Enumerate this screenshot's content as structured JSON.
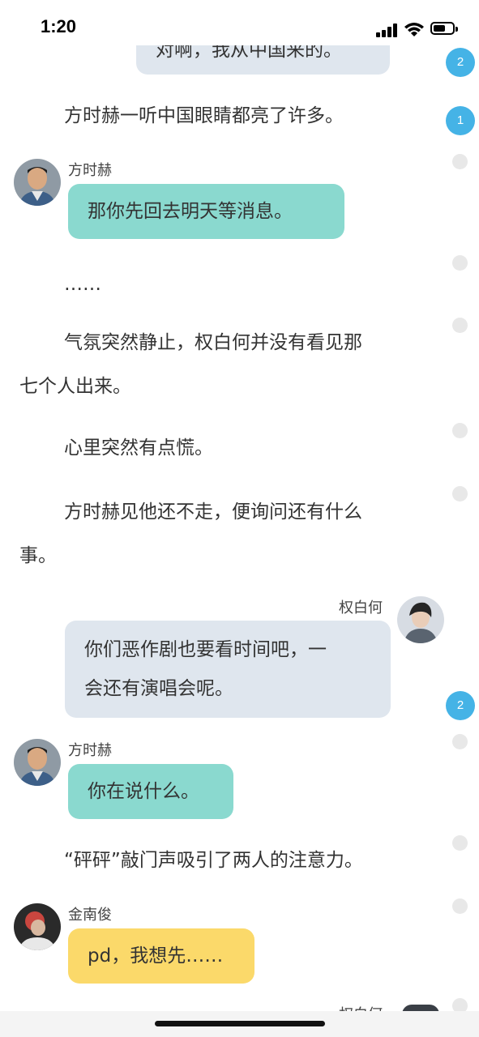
{
  "status": {
    "time": "1:20"
  },
  "top_partial_bubble": "对啊，我从中国来的。",
  "narration_1": "方时赫一听中国眼睛都亮了许多。",
  "msg1": {
    "name": "方时赫",
    "text": "那你先回去明天等消息。"
  },
  "narration_2": "……",
  "narration_3": {
    "line1": "气氛突然静止，权白何并没有看见那",
    "line2": "七个人出来。"
  },
  "narration_4": "心里突然有点慌。",
  "narration_5": {
    "line1": "方时赫见他还不走，便询问还有什么",
    "line2": "事。"
  },
  "msg2": {
    "name": "权白何",
    "line1": "你们恶作剧也要看时间吧，一",
    "line2": "会还有演唱会呢。"
  },
  "msg3": {
    "name": "方时赫",
    "text": "你在说什么。"
  },
  "narration_6": "“砰砰”敲门声吸引了两人的注意力。",
  "msg4": {
    "name": "金南俊",
    "text": "pd，我想先……"
  },
  "msg5_partial_name": "权白何",
  "badges": [
    "2",
    "1",
    "2"
  ],
  "colors": {
    "gray_bubble": "#dfe6ee",
    "teal_bubble": "#8ad9cf",
    "yellow_bubble": "#fbd96a",
    "badge": "#45b3e6"
  }
}
